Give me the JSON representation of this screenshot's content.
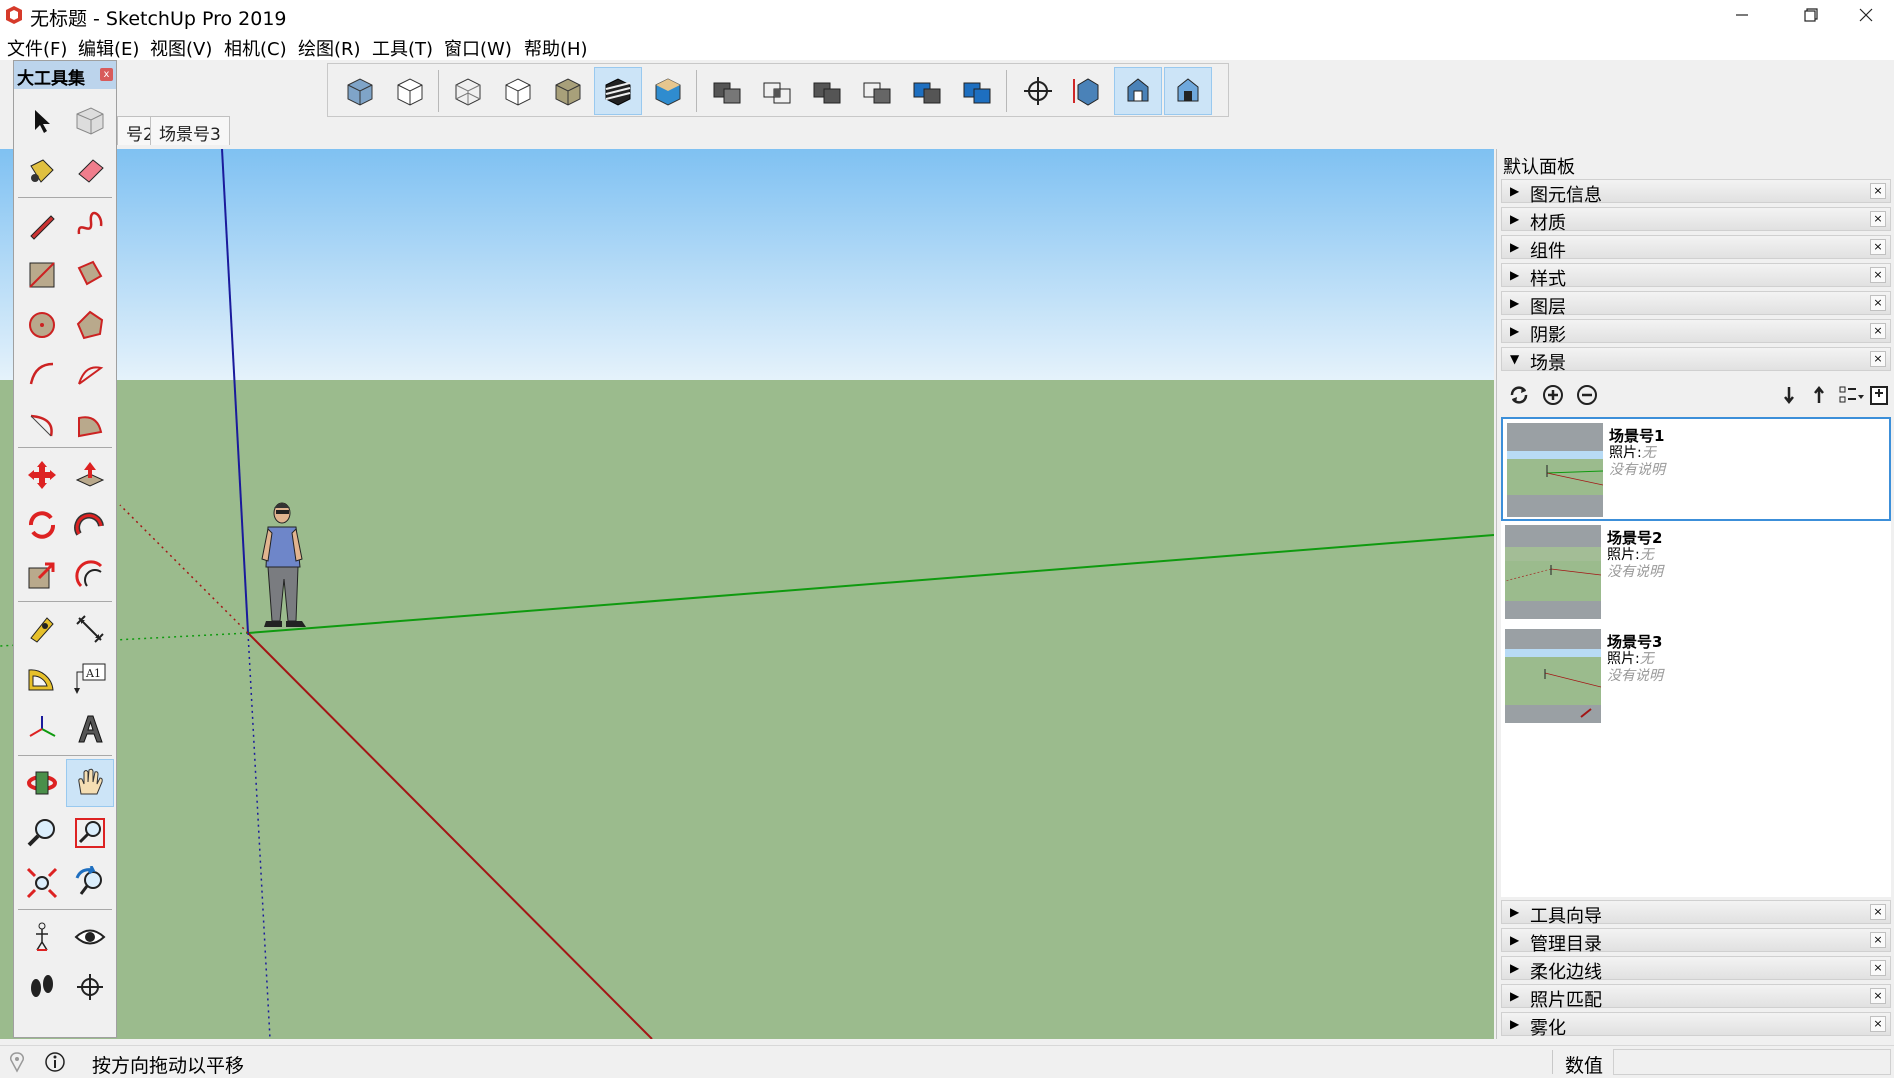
{
  "window": {
    "title": "无标题 - SketchUp Pro 2019"
  },
  "menu": [
    "文件(F)",
    "编辑(E)",
    "视图(V)",
    "相机(C)",
    "绘图(R)",
    "工具(T)",
    "窗口(W)",
    "帮助(H)"
  ],
  "tabs": {
    "partial": "号2",
    "scene3": "场景号3"
  },
  "large_tool_set": {
    "title": "大工具集",
    "close": "x",
    "active_tool": "pan-hand-icon",
    "tools": [
      "select-arrow-icon",
      "make-component-icon",
      "paint-bucket-icon",
      "eraser-icon",
      "pencil-line-icon",
      "freehand-icon",
      "rectangle-icon",
      "rotated-rectangle-icon",
      "circle-icon",
      "polygon-icon",
      "arc-icon",
      "two-point-arc-icon",
      "three-point-arc-icon",
      "pie-icon",
      "move-icon",
      "push-pull-icon",
      "rotate-icon",
      "follow-me-icon",
      "scale-icon",
      "offset-icon",
      "tape-measure-icon",
      "dimension-icon",
      "protractor-icon",
      "text-label-icon",
      "axes-icon",
      "3d-text-icon",
      "orbit-icon",
      "pan-hand-icon",
      "zoom-icon",
      "zoom-window-icon",
      "zoom-extents-icon",
      "previous-view-icon",
      "position-camera-icon",
      "look-around-icon",
      "walk-icon",
      "section-plane-icon"
    ],
    "text_label_glyph": "A1"
  },
  "tray": {
    "title": "默认面板",
    "panels_top": [
      {
        "label": "图元信息",
        "expanded": false
      },
      {
        "label": "材质",
        "expanded": false
      },
      {
        "label": "组件",
        "expanded": false
      },
      {
        "label": "样式",
        "expanded": false
      },
      {
        "label": "图层",
        "expanded": false
      },
      {
        "label": "阴影",
        "expanded": false
      },
      {
        "label": "场景",
        "expanded": true
      }
    ],
    "panels_bottom": [
      {
        "label": "工具向导",
        "expanded": false
      },
      {
        "label": "管理目录",
        "expanded": false
      },
      {
        "label": "柔化边线",
        "expanded": false
      },
      {
        "label": "照片匹配",
        "expanded": false
      },
      {
        "label": "雾化",
        "expanded": false
      }
    ],
    "close_glyph": "×",
    "scenes": [
      {
        "name": "场景号1",
        "photo_label": "照片:",
        "photo_value": "无",
        "description": "没有说明",
        "selected": true
      },
      {
        "name": "场景号2",
        "photo_label": "照片:",
        "photo_value": "无",
        "description": "没有说明",
        "selected": false
      },
      {
        "name": "场景号3",
        "photo_label": "照片:",
        "photo_value": "无",
        "description": "没有说明",
        "selected": false
      }
    ]
  },
  "status": {
    "hint": "按方向拖动以平移",
    "value_label": "数值",
    "value": ""
  },
  "colors": {
    "sky_top": "#7fc1f2",
    "sky_bottom": "#e5f2fb",
    "ground": "#9bbb8d",
    "axis_red": "#a31515",
    "axis_green": "#0f9a0f",
    "axis_blue": "#1a1a9c",
    "selection_blue": "#3c8fd9"
  }
}
